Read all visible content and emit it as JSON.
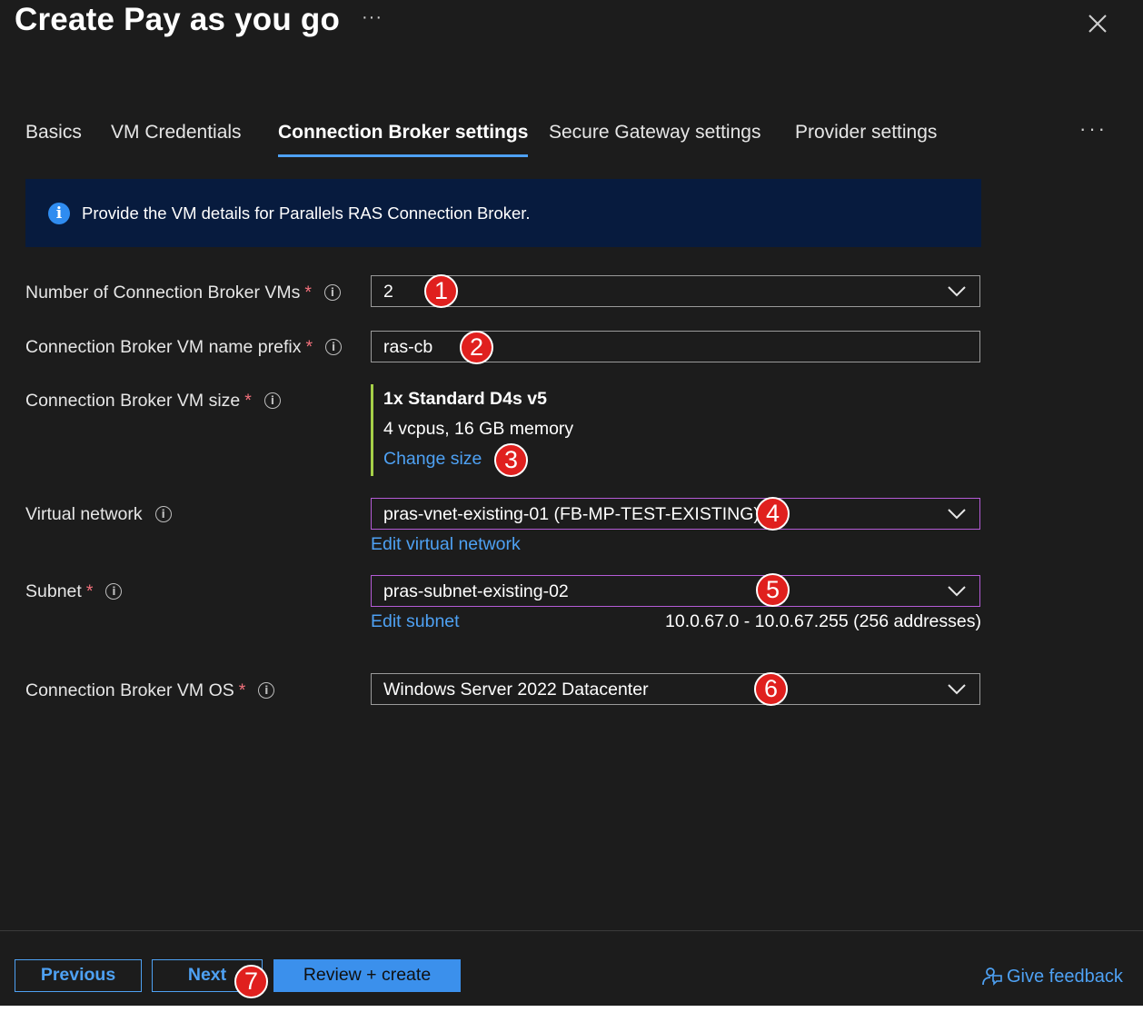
{
  "header": {
    "title": "Create Pay as you go",
    "more_label": "···"
  },
  "tabs": [
    {
      "label": "Basics"
    },
    {
      "label": "VM Credentials"
    },
    {
      "label": "Connection Broker settings",
      "active": true
    },
    {
      "label": "Secure Gateway settings"
    },
    {
      "label": "Provider settings"
    }
  ],
  "tabs_more": "···",
  "info_banner": {
    "icon": "info-icon",
    "text": "Provide the VM details for Parallels RAS Connection Broker."
  },
  "form": {
    "num_vms": {
      "label": "Number of Connection Broker VMs",
      "required": "*",
      "value": "2",
      "badge": "1"
    },
    "name_prefix": {
      "label": "Connection Broker VM name prefix",
      "required": "*",
      "value": "ras-cb",
      "badge": "2"
    },
    "vm_size": {
      "label": "Connection Broker VM size",
      "required": "*",
      "size_name": "1x Standard D4s v5",
      "size_detail": "4 vcpus, 16 GB memory",
      "change_link": "Change size",
      "badge": "3"
    },
    "virtual_network": {
      "label": "Virtual network",
      "value": "pras-vnet-existing-01 (FB-MP-TEST-EXISTING)",
      "edit_link": "Edit virtual network",
      "badge": "4"
    },
    "subnet": {
      "label": "Subnet",
      "required": "*",
      "value": "pras-subnet-existing-02",
      "edit_link": "Edit subnet",
      "range": "10.0.67.0 - 10.0.67.255 (256 addresses)",
      "badge": "5"
    },
    "vm_os": {
      "label": "Connection Broker VM OS",
      "required": "*",
      "value": "Windows Server 2022 Datacenter",
      "badge": "6"
    }
  },
  "footer": {
    "previous": "Previous",
    "next": "Next",
    "review_create": "Review + create",
    "feedback": "Give feedback",
    "badge": "7"
  },
  "colors": {
    "background": "#1c1c1c",
    "accent": "#4ea1f3",
    "info_banner": "#071b3e",
    "required": "#f1707b",
    "focus_border": "#b45bd6",
    "size_bar": "#a6d048",
    "badge": "#e0201e"
  }
}
